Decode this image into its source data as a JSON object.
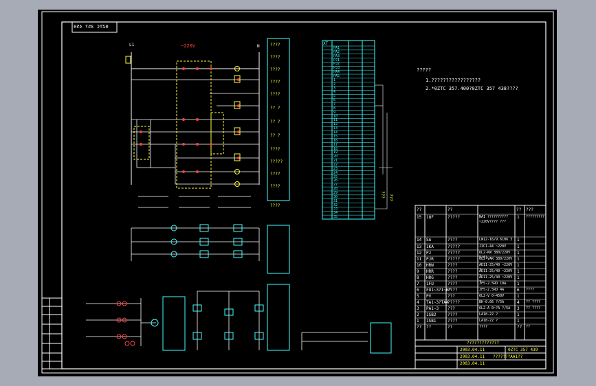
{
  "drawing_number_mirrored": "0ZTC 357 459",
  "voltage_label": "~220V",
  "top_nodes": {
    "left": "L1",
    "right": "N"
  },
  "relay_col_labels": [
    "????",
    "????",
    "????",
    "????",
    "????",
    "?? ?",
    "?? ?",
    "?? ?",
    "????",
    "?????",
    "????",
    "????",
    "????"
  ],
  "notes": {
    "title": "?????",
    "line1": "1.?????????????????",
    "line2": "2.*0ZTC 357.400?0ZTC 357 438????"
  },
  "terminal": {
    "header": "XT",
    "rows": [
      "PA1",
      "PA2",
      "PA3",
      "PJ1",
      "PJ2",
      "PJ3",
      "PA4",
      "PA5",
      "1",
      "2",
      "3",
      "4",
      "5",
      "6",
      "7",
      "8",
      "9",
      "10",
      "11",
      "12",
      "13",
      "14",
      "15",
      "16",
      "17",
      "18",
      "19",
      "20",
      "21",
      "22",
      "23",
      "24",
      "25",
      "26",
      "27",
      "28",
      "29",
      "30",
      "31",
      "32",
      "33",
      "34",
      "35"
    ]
  },
  "side_labels": {
    "a": "???",
    "b": "???"
  },
  "bom": {
    "header": {
      "no": "??",
      "code": "??",
      "name": "??",
      "spec": "",
      "qty": "??",
      "note": "???"
    },
    "rows": [
      {
        "no": "15",
        "code": "1QF",
        "name": "?????",
        "spec": "NAI ?????????? ~220V???? ???",
        "qty": "1",
        "note": "?????????"
      },
      {
        "no": "14",
        "code": "SA",
        "name": "????",
        "spec": "LW12-16/9.6106.3",
        "qty": "1",
        "note": ""
      },
      {
        "no": "13",
        "code": "1KA",
        "name": "?????",
        "spec": "JZC1-44 ~220V",
        "qty": "1",
        "note": ""
      },
      {
        "no": "12",
        "code": "PJ",
        "name": "?????",
        "spec": "6L2-KW 380/220V 5(6)",
        "qty": "1",
        "note": ""
      },
      {
        "no": "11",
        "code": "PJR",
        "name": "?????",
        "spec": "6L2-VAR 380/220V",
        "qty": "1",
        "note": ""
      },
      {
        "no": "10",
        "code": "HRW",
        "name": "????",
        "spec": "AD11-25/40 ~220V ?",
        "qty": "1",
        "note": ""
      },
      {
        "no": "9",
        "code": "HRR",
        "name": "????",
        "spec": "AD11-25/40 ~220V ?",
        "qty": "1",
        "note": ""
      },
      {
        "no": "8",
        "code": "HRG",
        "name": "????",
        "spec": "AD11-25/40 ~220V ?",
        "qty": "1",
        "note": ""
      },
      {
        "no": "7",
        "code": "1FU",
        "name": "????",
        "spec": "JF5-2.5RD 10A",
        "qty": "1",
        "note": ""
      },
      {
        "no": "6",
        "code": "FU1~3?1~6?",
        "name": "????",
        "spec": "JF5-2.5RD 4A",
        "qty": "6",
        "note": "????"
      },
      {
        "no": "5",
        "code": "PV",
        "name": "???",
        "spec": "6L2-V 0~450V",
        "qty": "1",
        "note": ""
      },
      {
        "no": "4",
        "code": "TA1~3?TA4",
        "name": "?????",
        "spec": "BH-0.66 ?/5A",
        "qty": "4",
        "note": "?? ????"
      },
      {
        "no": "3",
        "code": "PA1~3",
        "name": "???",
        "spec": "6L2-A 0~?A ?/5A",
        "qty": "3",
        "note": "?? ????"
      },
      {
        "no": "2",
        "code": "1SB2",
        "name": "????",
        "spec": "LA18-22 ?",
        "qty": "1",
        "note": ""
      },
      {
        "no": "1",
        "code": "1SB1",
        "name": "????",
        "spec": "LA18-22 ?",
        "qty": "1",
        "note": ""
      },
      {
        "no": "??",
        "code": "??",
        "name": "??",
        "spec": "????",
        "qty": "??",
        "note": "??"
      }
    ]
  },
  "title_block": {
    "project": "?????????????",
    "drawing_no": "0ZTC 357 439",
    "sheet_title": "???????AA1??",
    "date1": "2003.04.11",
    "date2": "2003.04.11",
    "date3": "2003.04.11",
    "footer": [
      "?",
      "?",
      "?",
      "?",
      "?",
      "?",
      "?"
    ]
  }
}
